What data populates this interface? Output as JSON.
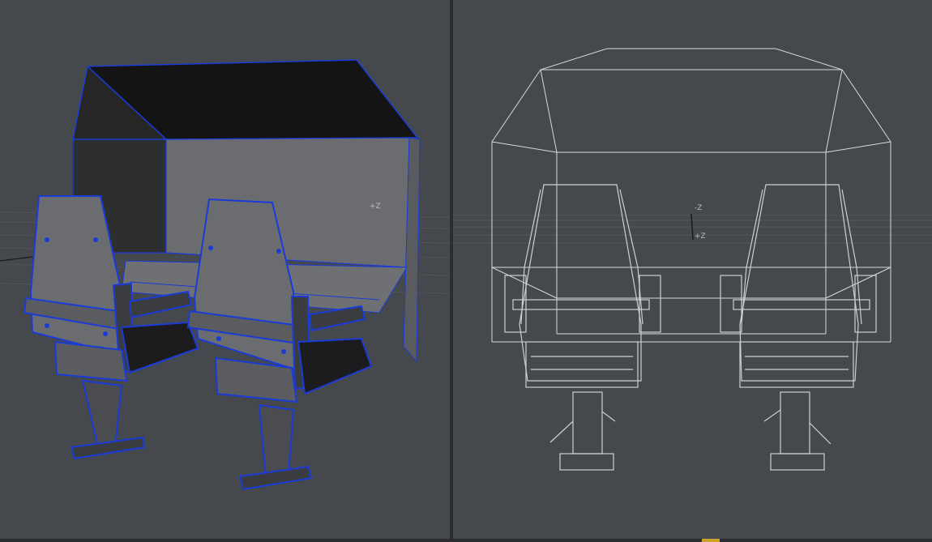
{
  "viewports": {
    "left": {
      "mode": "shaded-wireframe",
      "axis_label": "+Z"
    },
    "right": {
      "mode": "wireframe",
      "axis_label_neg": "-Z",
      "axis_label_pos": "+Z"
    }
  },
  "colors": {
    "background": "#45484c",
    "wire_blue": "#1a3bd6",
    "wire_white": "#d9d9d9",
    "accent": "#c9a227"
  },
  "icons": [
    "z-axis-gizmo-icon"
  ]
}
